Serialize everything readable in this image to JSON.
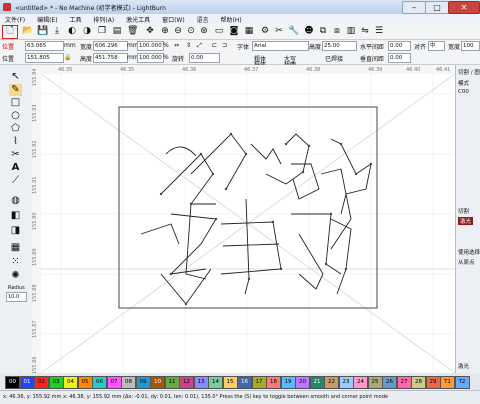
{
  "window": {
    "title": "<untitled> * - No Machine (初学者模式) - LightBurn"
  },
  "menu": [
    "文件(F)",
    "编辑(E)",
    "工具",
    "排列(A)",
    "激光工具",
    "窗口(W)",
    "语言",
    "帮助(H)"
  ],
  "toolbar_icons": [
    "new-file-icon",
    "open-icon",
    "save-icon",
    "import-icon",
    "cut-icon",
    "undo-icon",
    "redo-icon",
    "delete-icon",
    "move-icon",
    "zoom-in-icon",
    "zoom-out-icon",
    "zoom-fit-icon",
    "zoom-selection-icon",
    "camera-icon",
    "frame-icon",
    "settings-icon",
    "tools-icon",
    "user-icon",
    "group-icon",
    "ungroup-icon",
    "align-icon",
    "flip-icon",
    "distribute-icon"
  ],
  "position": {
    "label": "位置",
    "x_label": "位置",
    "x": "63.065",
    "y": "151.805",
    "unit": "mm"
  },
  "size": {
    "width_label": "宽度",
    "width": "606.296",
    "height_label": "高度",
    "height": "451.758",
    "unit": "mm",
    "pct_w": "100.000",
    "pct_h": "100.000",
    "pct": "%"
  },
  "rotate": {
    "label": "旋转",
    "value": "0.00"
  },
  "font": {
    "label": "字体",
    "value": "Arial",
    "height_label": "高度",
    "height": "25.00",
    "hspace_label": "水平间距",
    "hspace": "0.00",
    "vspace_label": "垂直间距",
    "vspace": "0.00",
    "align_label": "对齐",
    "align_value": "中",
    "width_label": "宽度",
    "width": "100",
    "bold": "粗体",
    "italic": "斜体",
    "upper": "大写",
    "weld": "已焊接",
    "distort": "扭曲"
  },
  "hruler": [
    "46.35",
    "46.35",
    "46.36",
    "46.37",
    "46.38",
    "46.39",
    "46.40",
    "46.41"
  ],
  "vruler": [
    "155.94",
    "155.93",
    "155.92",
    "155.91",
    "155.90",
    "155.89",
    "155.88",
    "155.87",
    "155.86"
  ],
  "right_panel": {
    "tab1": "切割 / 图层",
    "row_label": "模式",
    "row_value": "C00",
    "cut_label": "切割",
    "laser_tab": "激光",
    "tab2": "激光",
    "use_selection": "使用选择",
    "origin": "从原点"
  },
  "palette": [
    "00",
    "01",
    "02",
    "03",
    "04",
    "05",
    "06",
    "07",
    "08",
    "09",
    "10",
    "11",
    "12",
    "13",
    "14",
    "15",
    "16",
    "17",
    "18",
    "19",
    "20",
    "21",
    "22",
    "23",
    "24",
    "25",
    "26",
    "27",
    "28",
    "29",
    "T1",
    "T2"
  ],
  "palette_colors": [
    "#000000",
    "#2244ff",
    "#ff2222",
    "#22cc22",
    "#eeee22",
    "#ff8800",
    "#22cccc",
    "#ff55ff",
    "#bbbbbb",
    "#2299cc",
    "#aa5500",
    "#66aa44",
    "#cc4488",
    "#8888ff",
    "#77cc99",
    "#ffcc66",
    "#4466aa",
    "#aaaa22",
    "#ff7777",
    "#55bbff",
    "#bb77ff",
    "#228866",
    "#cc9966",
    "#99ccff",
    "#ff99cc",
    "#aaaa77",
    "#6699cc",
    "#ff66aa",
    "#cccc88",
    "#ee6644",
    "#ff9933",
    "#66aaff"
  ],
  "status": "x: 46.36, y: 155.92 mm  x: 46.38, y: 155.92 mm (Δx: -0.01, dy: 0.01, len: 0.01), 135.0°  Press the (S) key to toggle between smooth and corner point mode",
  "bottom_label": "激光",
  "left_tool_labels": {
    "radius_label": "Radius",
    "radius_value": "10.0"
  }
}
